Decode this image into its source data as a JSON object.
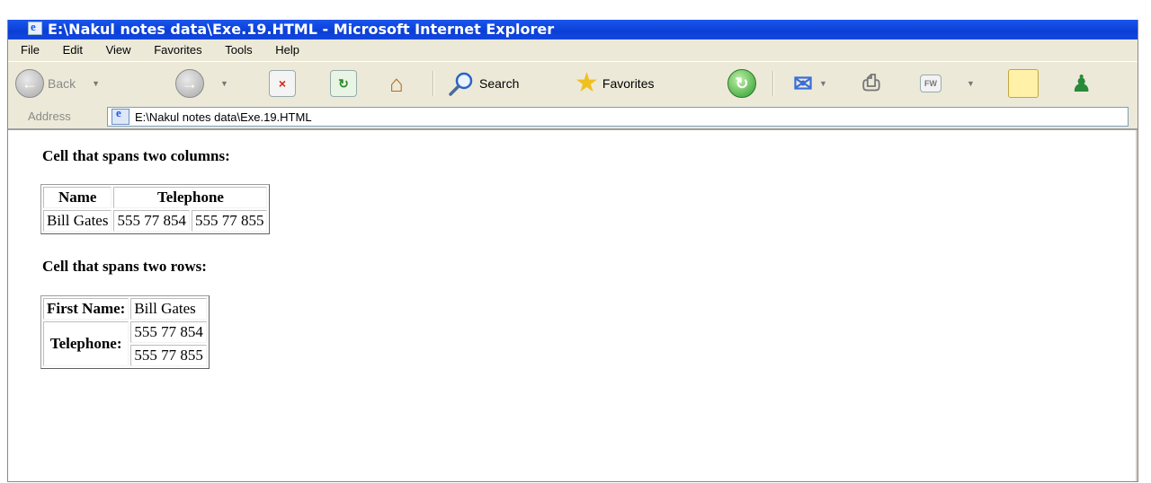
{
  "window": {
    "title": "E:\\Nakul notes data\\Exe.19.HTML - Microsoft Internet Explorer"
  },
  "menu": [
    "File",
    "Edit",
    "View",
    "Favorites",
    "Tools",
    "Help"
  ],
  "toolbar": {
    "back_label": "Back",
    "search_label": "Search",
    "favorites_label": "Favorites"
  },
  "address": {
    "label": "Address",
    "url": "E:\\Nakul notes data\\Exe.19.HTML"
  },
  "content": {
    "heading1": "Cell that spans two columns:",
    "table1": {
      "headers": [
        "Name",
        "Telephone"
      ],
      "row": [
        "Bill Gates",
        "555 77 854",
        "555 77 855"
      ]
    },
    "heading2": "Cell that spans two rows:",
    "table2": {
      "first_name_label": "First Name:",
      "first_name_value": "Bill Gates",
      "telephone_label": "Telephone:",
      "phones": [
        "555 77 854",
        "555 77 855"
      ]
    }
  },
  "colors": {
    "titlebar": "#0a3fd6",
    "chrome": "#ece9d8"
  }
}
